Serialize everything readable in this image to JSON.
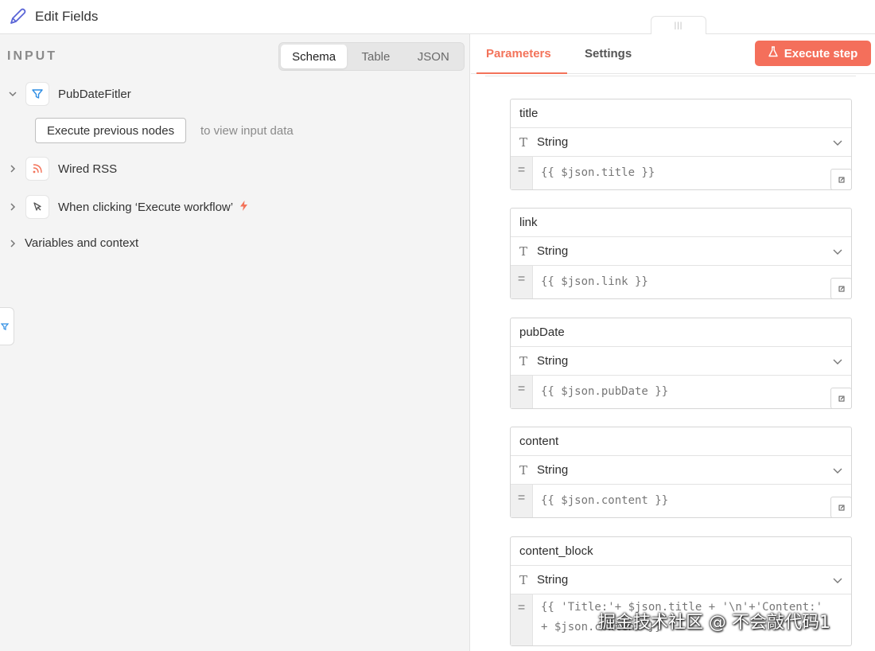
{
  "header": {
    "title": "Edit Fields",
    "icon": "pen-icon"
  },
  "input_panel": {
    "label": "INPUT",
    "view_tabs": [
      {
        "label": "Schema",
        "active": true
      },
      {
        "label": "Table",
        "active": false
      },
      {
        "label": "JSON",
        "active": false
      }
    ],
    "nodes": [
      {
        "name": "PubDateFitler",
        "icon": "filter-icon",
        "expanded": true
      },
      {
        "name": "Wired RSS",
        "icon": "rss-icon",
        "expanded": false
      },
      {
        "name": "When clicking ‘Execute workflow’",
        "icon": "cursor-icon",
        "expanded": false
      },
      {
        "name": "Variables and context",
        "expanded": false
      }
    ],
    "execute_previous_label": "Execute previous nodes",
    "execute_previous_hint": "to view input data"
  },
  "params_panel": {
    "tabs": [
      {
        "label": "Parameters",
        "active": true
      },
      {
        "label": "Settings",
        "active": false
      }
    ],
    "execute_step_label": "Execute step",
    "fields": [
      {
        "name": "title",
        "type": "String",
        "value": "{{ $json.title }}"
      },
      {
        "name": "link",
        "type": "String",
        "value": "{{ $json.link }}"
      },
      {
        "name": "pubDate",
        "type": "String",
        "value": "{{ $json.pubDate }}"
      },
      {
        "name": "content",
        "type": "String",
        "value": "{{ $json.content }}"
      },
      {
        "name": "content_block",
        "type": "String",
        "value": "{{ 'Title:'+ $json.title + '\\n'+'Content:' + $json.content }}"
      }
    ]
  },
  "colors": {
    "accent": "#f46f5b",
    "panel_bg": "#f4f4f4"
  },
  "watermark": "掘金技术社区 @ 不会敲代码1"
}
